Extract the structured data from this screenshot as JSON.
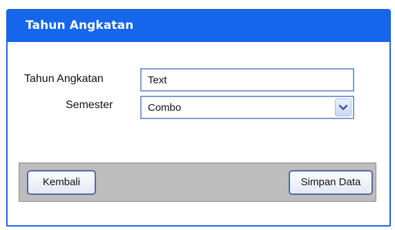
{
  "window": {
    "title": "Tahun Angkatan"
  },
  "form": {
    "tahun_angkatan_label": "Tahun Angkatan",
    "tahun_angkatan_value": "Text",
    "semester_label": "Semester",
    "semester_value": "Combo"
  },
  "buttons": {
    "back_label": "Kembali",
    "save_label": "Simpan Data"
  },
  "icons": {
    "combo_arrow": "chevron-down-icon"
  },
  "colors": {
    "titlebar": "#1566ea",
    "window_border": "#1a63e0",
    "button_bar": "#bdbdbd",
    "input_border": "#7d9ad0"
  }
}
